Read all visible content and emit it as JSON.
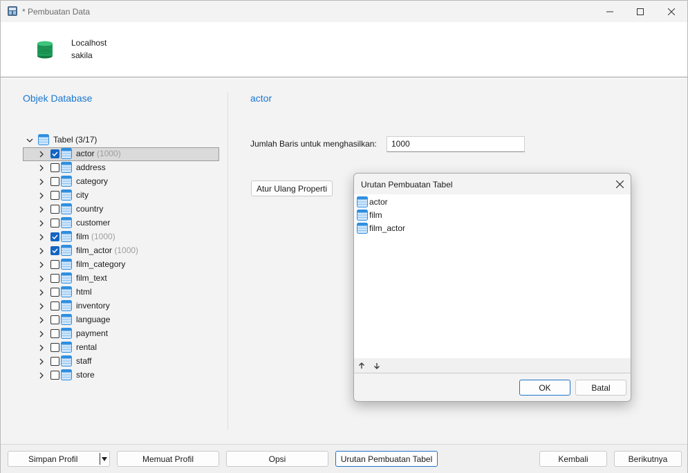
{
  "window": {
    "title": "* Pembuatan Data"
  },
  "connection": {
    "host": "Localhost",
    "database": "sakila"
  },
  "left_panel": {
    "title": "Objek Database",
    "tree_root": "Tabel (3/17)",
    "tables": [
      {
        "name": "actor",
        "checked": true,
        "count": "(1000)"
      },
      {
        "name": "address",
        "checked": false,
        "count": ""
      },
      {
        "name": "category",
        "checked": false,
        "count": ""
      },
      {
        "name": "city",
        "checked": false,
        "count": ""
      },
      {
        "name": "country",
        "checked": false,
        "count": ""
      },
      {
        "name": "customer",
        "checked": false,
        "count": ""
      },
      {
        "name": "film",
        "checked": true,
        "count": "(1000)"
      },
      {
        "name": "film_actor",
        "checked": true,
        "count": "(1000)"
      },
      {
        "name": "film_category",
        "checked": false,
        "count": ""
      },
      {
        "name": "film_text",
        "checked": false,
        "count": ""
      },
      {
        "name": "html",
        "checked": false,
        "count": ""
      },
      {
        "name": "inventory",
        "checked": false,
        "count": ""
      },
      {
        "name": "language",
        "checked": false,
        "count": ""
      },
      {
        "name": "payment",
        "checked": false,
        "count": ""
      },
      {
        "name": "rental",
        "checked": false,
        "count": ""
      },
      {
        "name": "staff",
        "checked": false,
        "count": ""
      },
      {
        "name": "store",
        "checked": false,
        "count": ""
      }
    ]
  },
  "right_panel": {
    "title": "actor",
    "rows_label": "Jumlah Baris untuk menghasilkan:",
    "rows_value": "1000",
    "reset_button": "Atur Ulang Properti"
  },
  "dialog": {
    "title": "Urutan Pembuatan Tabel",
    "items": [
      "actor",
      "film",
      "film_actor"
    ],
    "ok_label": "OK",
    "cancel_label": "Batal"
  },
  "footer": {
    "save_profile": "Simpan Profil",
    "load_profile": "Memuat Profil",
    "options": "Opsi",
    "table_order": "Urutan Pembuatan Tabel",
    "back": "Kembali",
    "next": "Berikutnya"
  },
  "colors": {
    "accent": "#1976d2",
    "checkbox_checked": "#1565c0",
    "db_icon": "#1e9e5a",
    "table_icon": "#2f8fe0"
  }
}
